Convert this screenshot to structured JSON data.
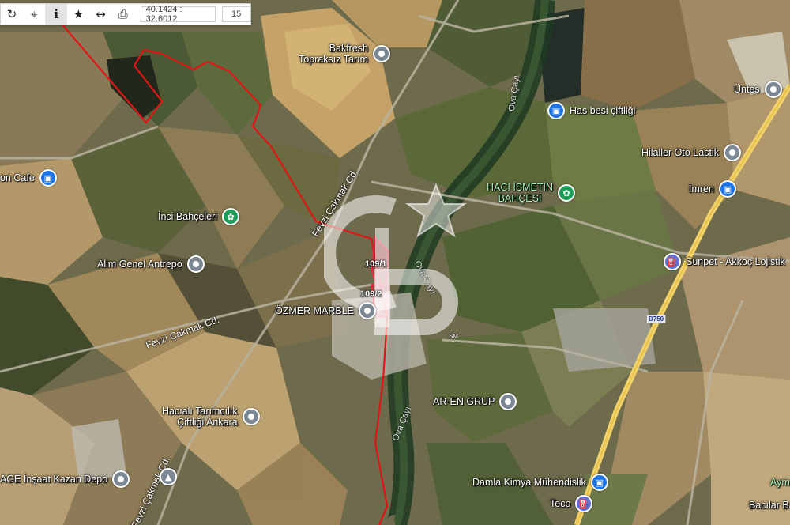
{
  "toolbar": {
    "coords": "40.1424 : 32.6012",
    "zoom": "15",
    "icons": [
      "refresh-icon",
      "crosshair-icon",
      "info-icon",
      "star-icon",
      "measure-icon",
      "print-icon"
    ]
  },
  "roads": {
    "fevzi_1": "Fevzi Çakmak Cd.",
    "fevzi_2": "Fevzi Çakmak Cd.",
    "fevzi_3": "Fevzi Çakmak Cd.",
    "d750": "D750",
    "sm": "SM"
  },
  "rivers": {
    "ova_1": "Ova Çayı",
    "ova_2": "Ova Çayı",
    "ova_3": "Ova Çayı"
  },
  "parcels": {
    "p1": "109/1",
    "p2": "109/2"
  },
  "pois": {
    "bakfresh_1": "Bakfresh",
    "bakfresh_2": "Topraksız Tarım",
    "has_besi": "Has besi çiftliği",
    "untes": "Üntes",
    "hilaller": "Hilaller Oto Lastik",
    "imren": "İmren",
    "haci_1": "HACI İSMETİN",
    "haci_2": "BAHÇESİ",
    "inci": "İnci Bahçeleri",
    "on_cafe": "on Cafe",
    "alim": "Alim Genel Antrepo",
    "ozmer": "ÖZMER MARBLE",
    "sunpet": "Sunpet - Akkoç Lojistik",
    "ar_en": "AR-EN GRUP",
    "hacali_1": "Hacıalı Tarımcılık",
    "hacali_2": "Çiftliği Ankara",
    "age": "AGE İnşaat Kazan Depo",
    "damla": "Damla Kimya Mühendislik",
    "teco": "Teco",
    "aym": "Aym",
    "bacilar": "Bacılar Ba"
  },
  "colors": {
    "boundary": "#e01515",
    "parcel_fill": "#c8102e",
    "poi_grey": "#7c8794",
    "poi_blue": "#1a73e8",
    "poi_green": "#1e9e58",
    "highway": "#f2d36b"
  }
}
